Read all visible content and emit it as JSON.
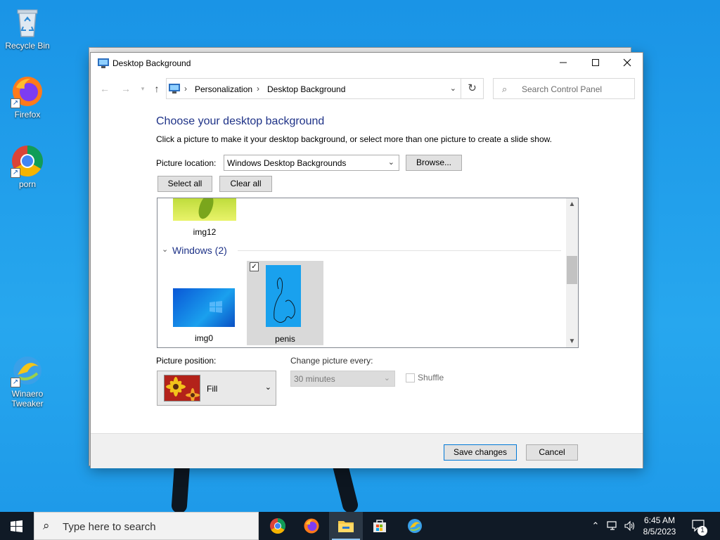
{
  "desktop": {
    "icons": [
      {
        "label": "Recycle Bin",
        "icon": "recycle-bin-icon"
      },
      {
        "label": "Firefox",
        "icon": "firefox-icon"
      },
      {
        "label": "porn",
        "icon": "chrome-icon"
      },
      {
        "label": "Winaero Tweaker",
        "icon": "winaero-tweaker-icon"
      }
    ]
  },
  "window": {
    "title": "Desktop Background",
    "breadcrumb": [
      "Personalization",
      "Desktop Background"
    ],
    "search_placeholder": "Search Control Panel",
    "heading": "Choose your desktop background",
    "subtext": "Click a picture to make it your desktop background, or select more than one picture to create a slide show.",
    "picture_location_label": "Picture location:",
    "picture_location_value": "Windows Desktop Backgrounds",
    "browse_label": "Browse...",
    "select_all_label": "Select all",
    "clear_all_label": "Clear all",
    "gallery": {
      "partial_item": "img12",
      "group_name": "Windows (2)",
      "items": [
        {
          "label": "img0",
          "selected": false
        },
        {
          "label": "penis",
          "selected": true
        }
      ]
    },
    "picture_position_label": "Picture position:",
    "picture_position_value": "Fill",
    "change_every_label": "Change picture every:",
    "change_every_value": "30 minutes",
    "shuffle_label": "Shuffle",
    "save_label": "Save changes",
    "cancel_label": "Cancel"
  },
  "taskbar": {
    "search_placeholder": "Type here to search",
    "apps": [
      "chrome-icon",
      "firefox-icon",
      "file-explorer-icon",
      "store-icon",
      "winaero-tweaker-icon"
    ],
    "time": "6:45 AM",
    "date": "8/5/2023",
    "notification_count": "1"
  },
  "colors": {
    "accent": "#1e3287",
    "desktop": "#1f9ce8",
    "taskbar": "#101a26"
  }
}
